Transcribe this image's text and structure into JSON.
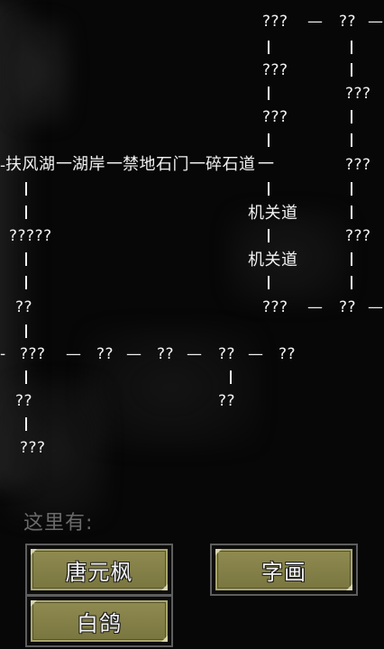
{
  "map": {
    "nodes": [
      {
        "id": "n1",
        "text": "???"
      },
      {
        "id": "n2",
        "text": "??"
      },
      {
        "id": "n3",
        "text": "???"
      },
      {
        "id": "n4",
        "text": "???"
      },
      {
        "id": "n5",
        "text": "???"
      },
      {
        "id": "n6",
        "text": "扶风湖"
      },
      {
        "id": "n7",
        "text": "湖岸"
      },
      {
        "id": "n8",
        "text": "禁地石门"
      },
      {
        "id": "n9",
        "text": "碎石道"
      },
      {
        "id": "n10",
        "text": "???"
      },
      {
        "id": "n11",
        "text": "机关道"
      },
      {
        "id": "n12",
        "text": "?????"
      },
      {
        "id": "n13",
        "text": "???"
      },
      {
        "id": "n14",
        "text": "机关道"
      },
      {
        "id": "n15",
        "text": "??"
      },
      {
        "id": "n16",
        "text": "???"
      },
      {
        "id": "n17",
        "text": "??"
      },
      {
        "id": "n18",
        "text": "???"
      },
      {
        "id": "n19",
        "text": "??"
      },
      {
        "id": "n20",
        "text": "??"
      },
      {
        "id": "n21",
        "text": "??"
      },
      {
        "id": "n22",
        "text": "??"
      },
      {
        "id": "n23",
        "text": "??"
      },
      {
        "id": "n24",
        "text": "??"
      },
      {
        "id": "n25",
        "text": "???"
      }
    ],
    "connector_h": "—",
    "connector_h_long": "一"
  },
  "here": {
    "label": "这里有:",
    "items": [
      {
        "id": "tang",
        "text": "唐元枫"
      },
      {
        "id": "zihua",
        "text": "字画"
      },
      {
        "id": "baige",
        "text": "白鸽"
      }
    ]
  },
  "colors": {
    "background": "#070707",
    "text": "#f2f2f2",
    "button_face": "#847f48",
    "button_border": "#5e5e5e",
    "label_gray": "#6a6a6a"
  }
}
